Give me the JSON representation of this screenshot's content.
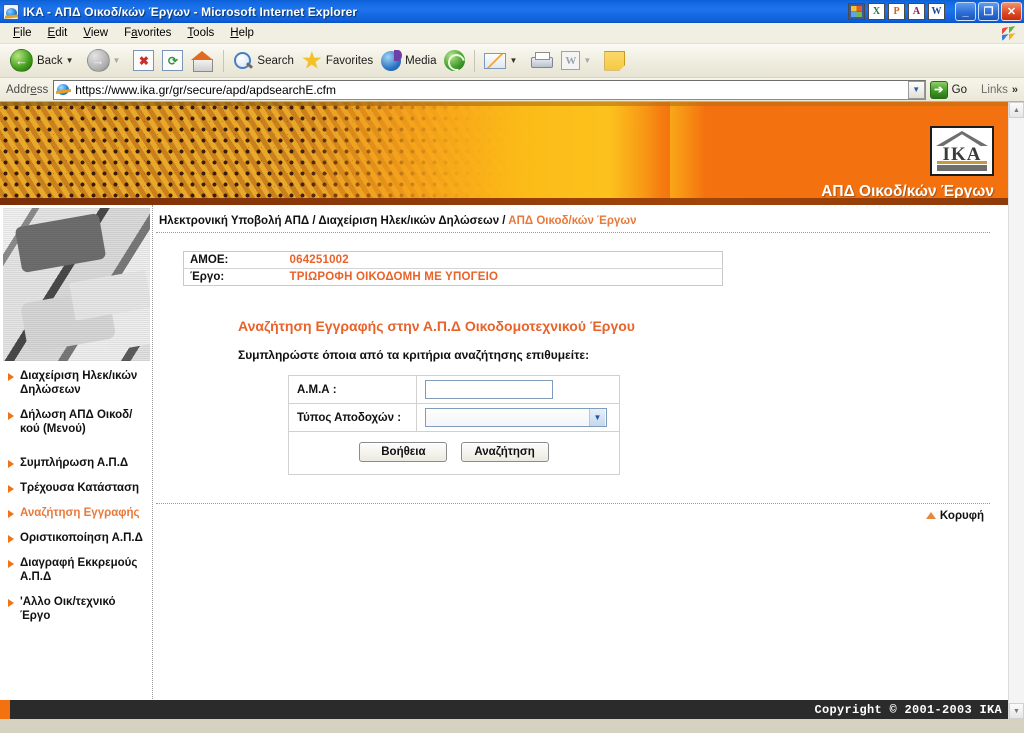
{
  "window": {
    "title": "IKA - ΑΠΔ Οικοδ/κών Έργων - Microsoft Internet Explorer",
    "app_icon": "ie-icon",
    "minimize": "_",
    "maximize": "❐",
    "close": "✕",
    "office_shortcuts": [
      {
        "name": "office-shortcut-bar-icon",
        "glyph": ""
      },
      {
        "name": "excel-icon",
        "glyph": "X"
      },
      {
        "name": "powerpoint-icon",
        "glyph": "P"
      },
      {
        "name": "access-icon",
        "glyph": "A"
      },
      {
        "name": "word-icon",
        "glyph": "W"
      }
    ]
  },
  "menubar": {
    "items": [
      {
        "label": "File",
        "accel": "F"
      },
      {
        "label": "Edit",
        "accel": "E"
      },
      {
        "label": "View",
        "accel": "V"
      },
      {
        "label": "Favorites",
        "accel": "a"
      },
      {
        "label": "Tools",
        "accel": "T"
      },
      {
        "label": "Help",
        "accel": "H"
      }
    ]
  },
  "toolbar": {
    "back_label": "Back",
    "search_label": "Search",
    "favorites_label": "Favorites",
    "media_label": "Media",
    "icons": [
      "back-icon",
      "forward-icon",
      "stop-icon",
      "refresh-icon",
      "home-icon",
      "search-icon",
      "favorites-star-icon",
      "media-icon",
      "history-icon",
      "mail-icon",
      "print-icon",
      "edit-word-icon",
      "notes-icon"
    ]
  },
  "address_bar": {
    "label": "Address",
    "url": "https://www.ika.gr/gr/secure/apd/apdsearchE.cfm",
    "go_label": "Go",
    "links_label": "Links",
    "chevrons": "»",
    "dropdown_glyph": "▼"
  },
  "banner": {
    "site_title": "ΑΠΔ Οικοδ/κών Έργων",
    "logo_text": "IKA",
    "logo_name": "ika-logo"
  },
  "breadcrumb": {
    "part1": "Ηλεκτρονική Υποβολή ΑΠΔ",
    "sep": " / ",
    "part2": "Διαχείριση Ηλεκ/ικών Δηλώσεων",
    "current": "ΑΠΔ Οικοδ/κών Έργων"
  },
  "sidebar": {
    "image_name": "keyboard-photo",
    "items": [
      {
        "label": "Διαχείριση Ηλεκ/ικών Δηλώσεων",
        "active": false
      },
      {
        "label": "Δήλωση ΑΠΔ Οικοδ/κού (Μενού)",
        "active": false
      },
      {
        "label": "Συμπλήρωση Α.Π.Δ",
        "active": false
      },
      {
        "label": "Τρέχουσα Κατάσταση",
        "active": false
      },
      {
        "label": "Αναζήτηση Εγγραφής",
        "active": true
      },
      {
        "label": "Οριστικοποίηση Α.Π.Δ",
        "active": false
      },
      {
        "label": "Διαγραφή Εκκρεμούς Α.Π.Δ",
        "active": false
      },
      {
        "label": "'Αλλο Οικ/τεχνικό Έργο",
        "active": false
      }
    ]
  },
  "info": {
    "rows": [
      {
        "key": "ΑΜΟΕ:",
        "value": "064251002"
      },
      {
        "key": "Έργο:",
        "value": "ΤΡΙΩΡΟΦΗ ΟΙΚΟΔΟΜΗ ΜΕ ΥΠΟΓΕΙΟ"
      }
    ]
  },
  "form": {
    "title": "Αναζήτηση Εγγραφής στην Α.Π.Δ Οικοδομοτεχνικού Έργου",
    "subtitle": "Συμπληρώστε όποια από τα κριτήρια αναζήτησης επιθυμείτε:",
    "ama_label": "Α.Μ.Α :",
    "ama_value": "",
    "type_label": "Τύπος Αποδοχών :",
    "type_value": "",
    "select_arrow": "▼",
    "help_button": "Βοήθεια",
    "search_button": "Αναζήτηση"
  },
  "page_footer": {
    "top_link": "Κορυφή",
    "copyright": "Copyright © 2001-2003 IKA"
  },
  "colors": {
    "accent_orange": "#e8622a",
    "banner_orange": "#f4710f",
    "link_orange": "#e8793a",
    "title_blue": "#1d74ec"
  }
}
